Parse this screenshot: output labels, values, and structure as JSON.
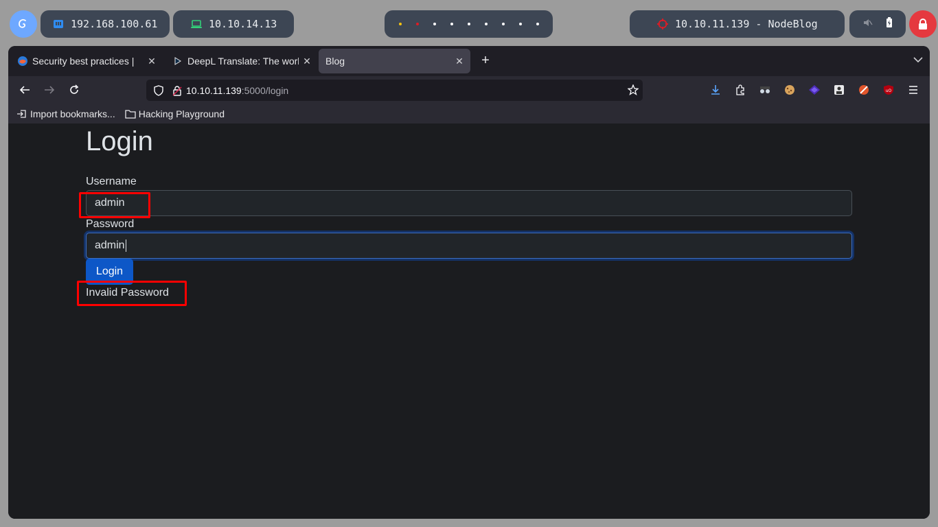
{
  "desktop_bar": {
    "local_ip": "192.168.100.61",
    "vpn_ip": "10.10.14.13",
    "target": "10.10.11.139 - NodeBlog",
    "workspace_dot_colors": [
      "#f5c211",
      "#e01b24",
      "#ffffff",
      "#ffffff",
      "#ffffff",
      "#ffffff",
      "#ffffff",
      "#ffffff",
      "#ffffff"
    ],
    "icons": {
      "os": "debian-swirl-icon",
      "local": "network-card-icon",
      "vpn": "laptop-icon",
      "target": "crosshair-icon",
      "mute": "speaker-muted-icon",
      "battery": "battery-icon",
      "lock": "lock-icon"
    }
  },
  "browser": {
    "tabs": [
      {
        "title": "Security best practices | ",
        "icon": "firefox-globe-icon"
      },
      {
        "title": "DeepL Translate: The world",
        "icon": "deepl-icon"
      },
      {
        "title": "Blog",
        "icon": "",
        "active": true
      }
    ],
    "url": {
      "host": "10.10.11.139",
      "rest": ":5000/login"
    },
    "bookmarks": [
      {
        "label": "Import bookmarks...",
        "icon": "import-icon"
      },
      {
        "label": "Hacking Playground",
        "icon": "folder-icon"
      }
    ]
  },
  "page": {
    "title": "Login",
    "username_label": "Username",
    "username_value": "admin",
    "password_label": "Password",
    "password_value": "admin",
    "login_button": "Login",
    "error_message": "Invalid Password"
  },
  "colors": {
    "accent_blue": "#0d57c7",
    "highlight_red": "#ff0000",
    "page_bg": "#1b1c1f"
  }
}
